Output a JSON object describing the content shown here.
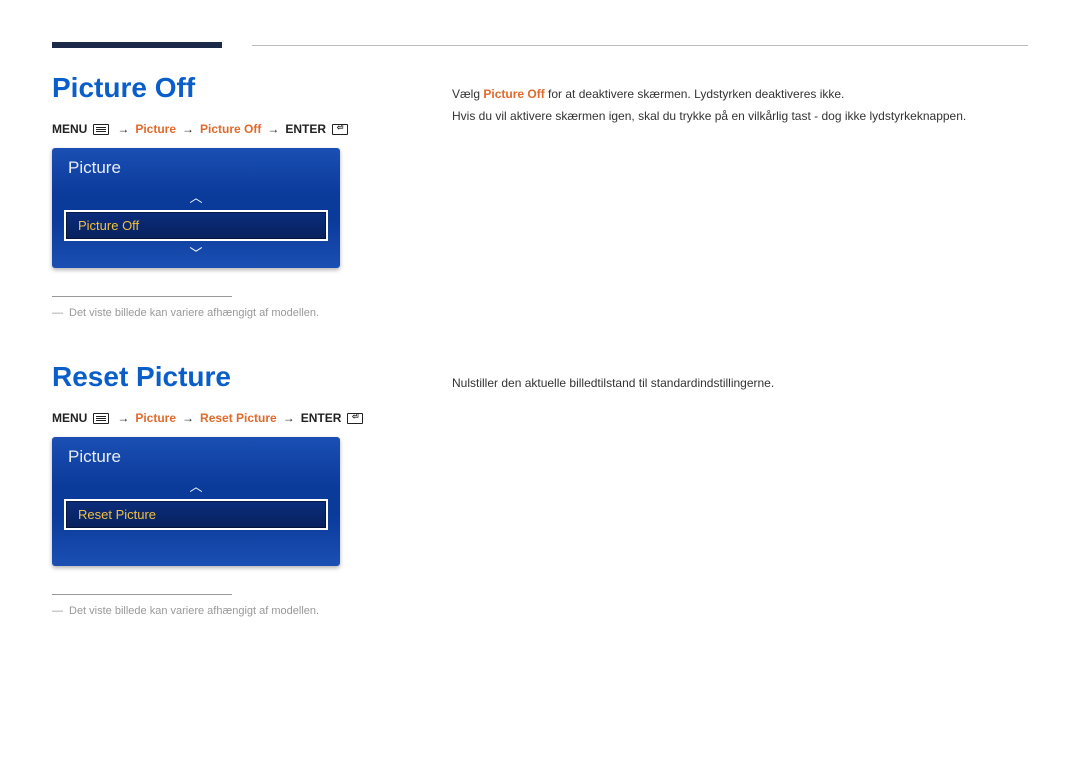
{
  "section1": {
    "title": "Picture Off",
    "breadcrumb": {
      "menu": "MENU",
      "p1": "Picture",
      "p2": "Picture Off",
      "enter": "ENTER"
    },
    "menu": {
      "header": "Picture",
      "selected": "Picture Off"
    },
    "footnote": "Det viste billede kan variere afhængigt af modellen.",
    "desc": {
      "line1a": "Vælg ",
      "line1b": "Picture Off",
      "line1c": " for at deaktivere skærmen. Lydstyrken deaktiveres ikke.",
      "line2": "Hvis du vil aktivere skærmen igen, skal du trykke på en vilkårlig tast - dog ikke lydstyrkeknappen."
    }
  },
  "section2": {
    "title": "Reset Picture",
    "breadcrumb": {
      "menu": "MENU",
      "p1": "Picture",
      "p2": "Reset Picture",
      "enter": "ENTER"
    },
    "menu": {
      "header": "Picture",
      "selected": "Reset Picture"
    },
    "footnote": "Det viste billede kan variere afhængigt af modellen.",
    "desc": {
      "line1": "Nulstiller den aktuelle billedtilstand til standardindstillingerne."
    }
  }
}
